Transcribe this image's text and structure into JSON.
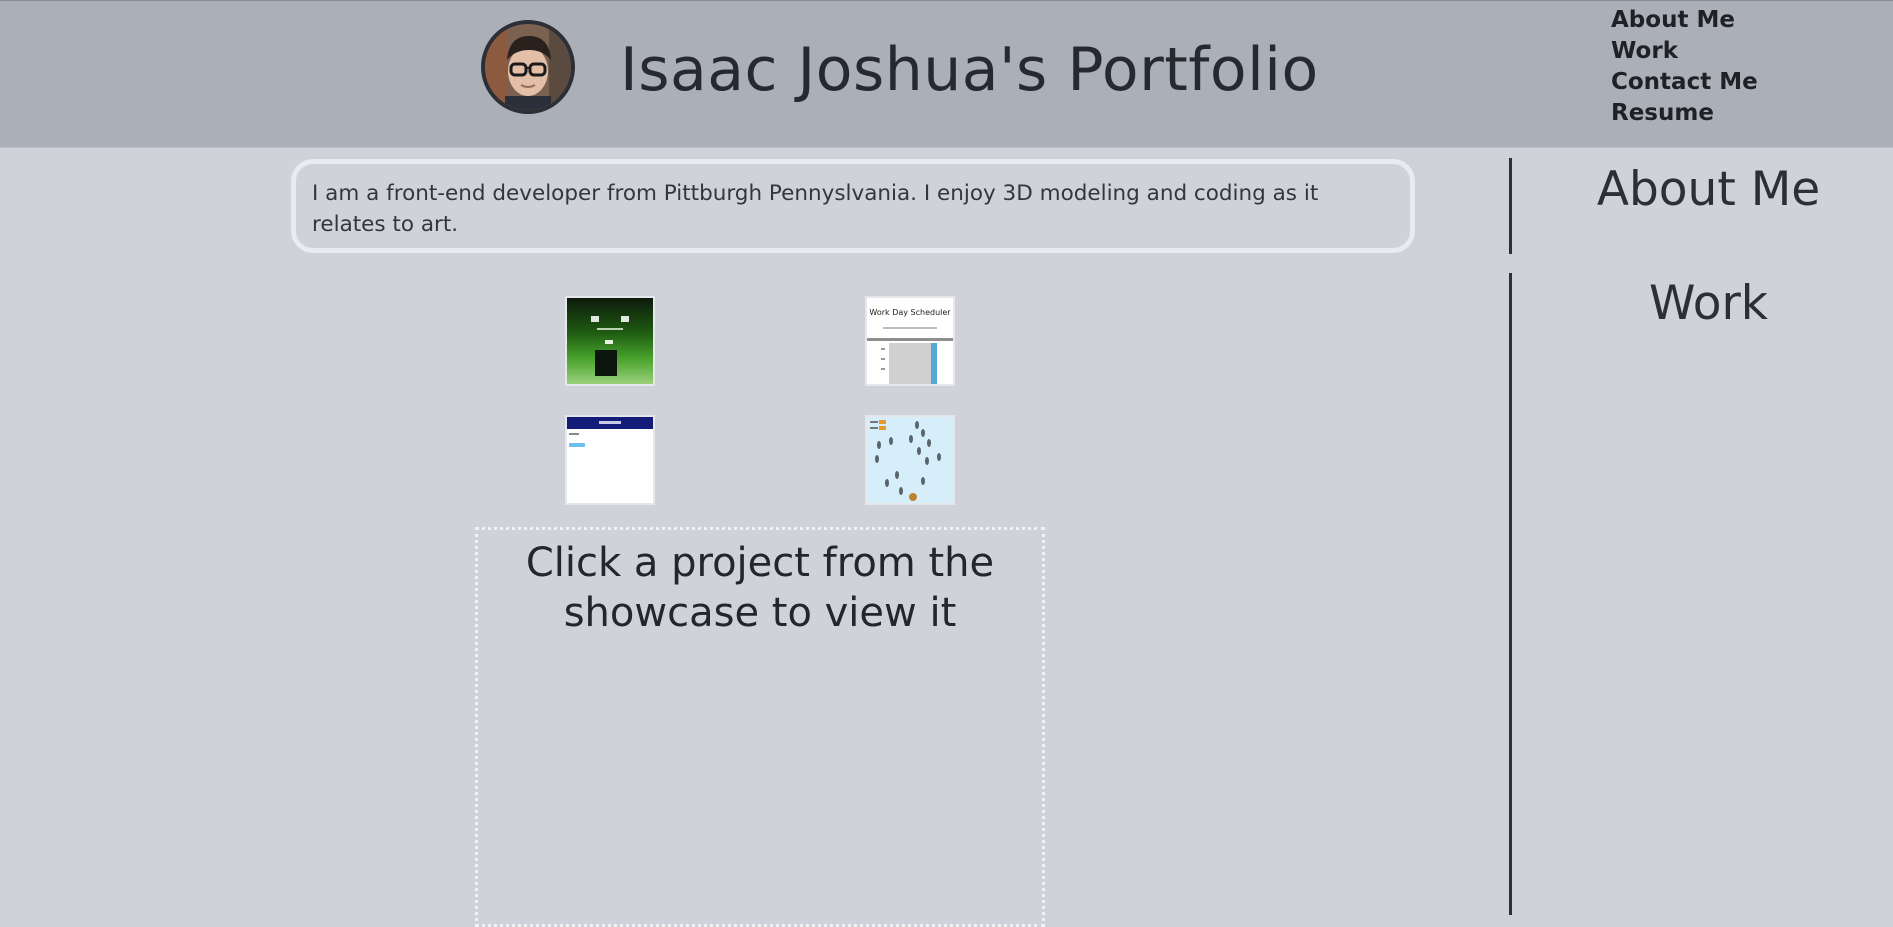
{
  "header": {
    "title": "Isaac Joshua's Portfolio",
    "avatar_icon": "profile-photo",
    "nav": [
      {
        "label": "About Me"
      },
      {
        "label": "Work"
      },
      {
        "label": "Contact Me"
      },
      {
        "label": "Resume"
      }
    ]
  },
  "intro": {
    "text": "I am a front-end developer from Pittburgh Pennyslvania. I enjoy 3D modeling and coding as it relates to art."
  },
  "side": {
    "about_heading": "About Me",
    "work_heading": "Work"
  },
  "showcase": {
    "thumb_two_title": "Work Day Scheduler",
    "viewer_text": "Click a project from the showcase to view it"
  },
  "colors": {
    "background": "#cfd3d9",
    "header": "#abb0b8",
    "text": "#262930"
  }
}
